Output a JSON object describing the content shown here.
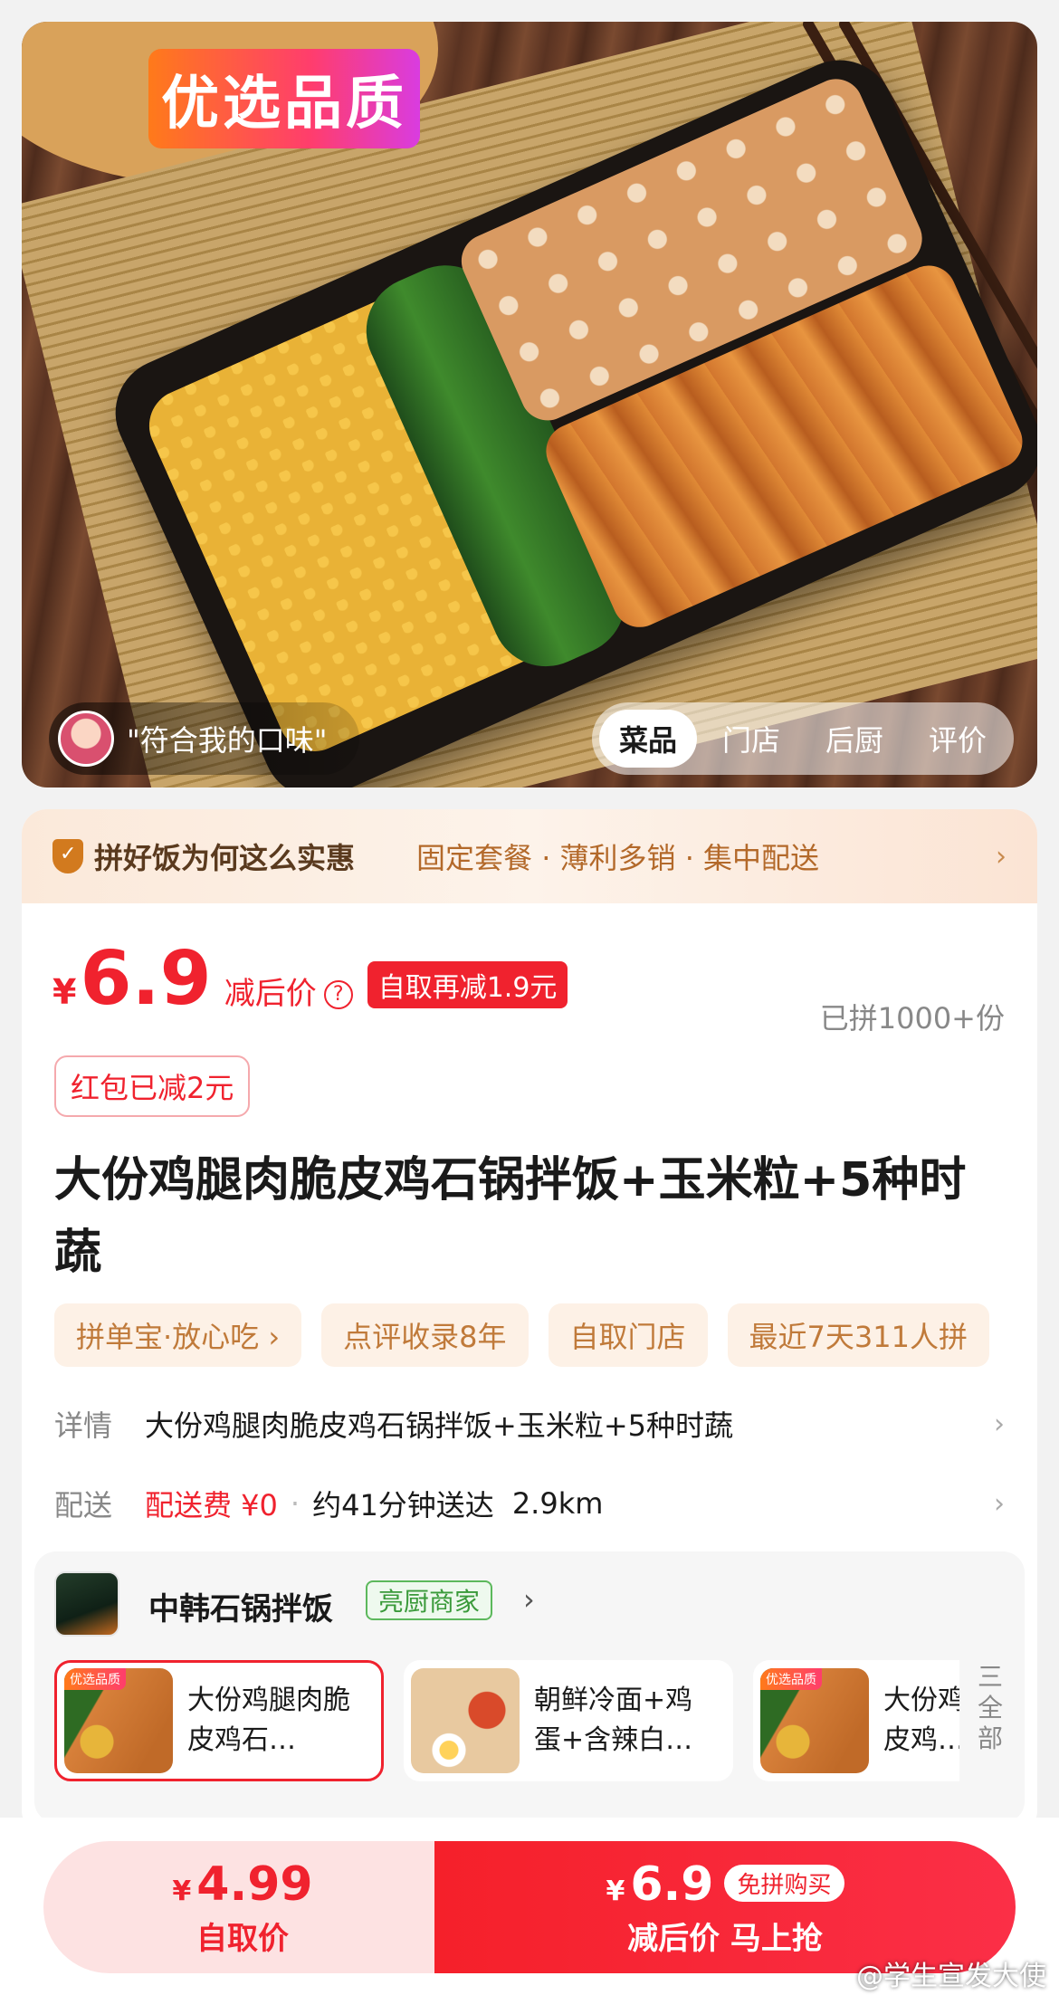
{
  "hero": {
    "badge": "优选品质",
    "review_quote": "\"符合我的口味\"",
    "tabs": [
      "菜品",
      "门店",
      "后厨",
      "评价"
    ]
  },
  "promo": {
    "title": "拼好饭为何这么实惠",
    "points": "固定套餐 · 薄利多销 · 集中配送",
    "chevron": "›"
  },
  "price": {
    "currency": "¥",
    "value": "6.9",
    "label": "减后价",
    "help_icon": "?",
    "pickup_discount": "自取再减1.9元",
    "sold": "已拼1000+份",
    "red_packet": "红包已减2元"
  },
  "product": {
    "title": "大份鸡腿肉脆皮鸡石锅拌饭+玉米粒+5种时蔬",
    "tags": [
      "拼单宝·放心吃 ›",
      "点评收录8年",
      "自取门店",
      "最近7天311人拼"
    ]
  },
  "details": {
    "label": "详情",
    "value": "大份鸡腿肉脆皮鸡石锅拌饭+玉米粒+5种时蔬"
  },
  "delivery": {
    "label": "配送",
    "fee": "配送费 ¥0",
    "time": "约41分钟送达",
    "distance": "2.9km"
  },
  "store": {
    "name": "中韩石锅拌饭",
    "badge": "亮厨商家",
    "dishes": [
      {
        "name": "大份鸡腿肉脆皮鸡石…",
        "tag": "优选品质"
      },
      {
        "name": "朝鲜冷面+鸡蛋+含辣白…",
        "tag": ""
      },
      {
        "name": "大份鸡腿肉脆皮鸡…",
        "tag": "优选品质"
      }
    ],
    "all_label": "三全部"
  },
  "bottom": {
    "left_currency": "¥",
    "left_price": "4.99",
    "left_label": "自取价",
    "right_currency": "¥",
    "right_price": "6.9",
    "right_tag": "免拼购买",
    "right_label": "减后价 马上抢"
  },
  "watermark": "@学生宣发大使",
  "colors": {
    "accent_red": "#f0222e",
    "promo_brown": "#b3692a",
    "badge_green": "#3a9a3a"
  }
}
